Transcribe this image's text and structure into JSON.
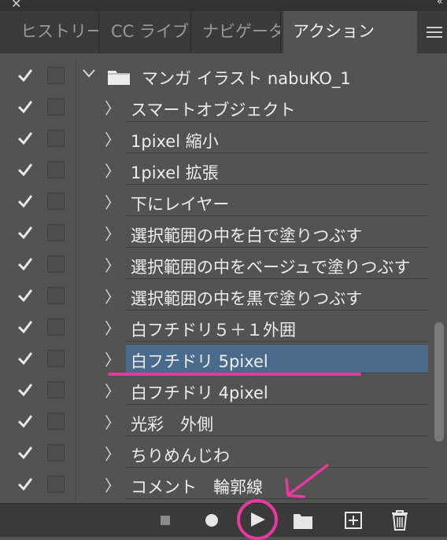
{
  "window": {
    "close_glyph": "✕",
    "collapse_glyph": "‹‹"
  },
  "tabs": [
    {
      "label": "ヒストリー",
      "active": false
    },
    {
      "label": "CC ライブラリ",
      "active": false
    },
    {
      "label": "ナビゲーター",
      "active": false
    },
    {
      "label": "アクション",
      "active": true
    }
  ],
  "actions": {
    "set_name": "マンガ イラスト nabuKO_1",
    "items": [
      {
        "label": "スマートオブジェクト"
      },
      {
        "label": "1pixel 縮小"
      },
      {
        "label": "1pixel 拡張"
      },
      {
        "label": "下にレイヤー"
      },
      {
        "label": "選択範囲の中を白で塗りつぶす"
      },
      {
        "label": "選択範囲の中をベージュで塗りつぶす"
      },
      {
        "label": "選択範囲の中を黒で塗りつぶす"
      },
      {
        "label": "白フチドリ５＋１外囲"
      },
      {
        "label": "白フチドリ 5pixel",
        "selected": true
      },
      {
        "label": "白フチドリ 4pixel"
      },
      {
        "label": "光彩　外側"
      },
      {
        "label": "ちりめんじわ"
      },
      {
        "label": "コメント　輪郭線"
      }
    ]
  },
  "toolbar": {
    "buttons": [
      "stop-icon",
      "record-icon",
      "play-icon",
      "folder-icon",
      "new-action-icon",
      "trash-icon"
    ]
  },
  "colors": {
    "panel_bg": "#535353",
    "tab_bar_bg": "#3b3b3b",
    "selection_bg": "#4b6b8c",
    "annotation_pink": "#e8399e"
  }
}
